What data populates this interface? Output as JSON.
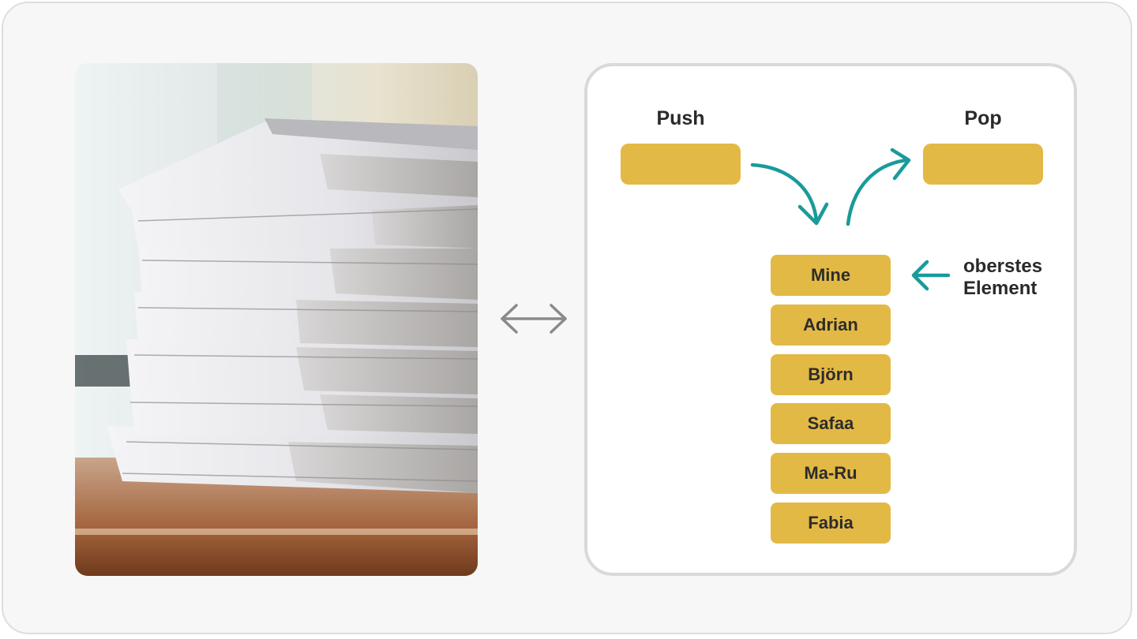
{
  "diagram": {
    "push_label": "Push",
    "pop_label": "Pop",
    "stack_items": [
      "Mine",
      "Adrian",
      "Björn",
      "Safaa",
      "Ma-Ru",
      "Fabia"
    ],
    "top_note_line1": "oberstes",
    "top_note_line2": "Element"
  },
  "colors": {
    "block": "#e3b945",
    "arrow_teal": "#1a9a9a",
    "arrow_gray": "#8a8a8a",
    "panel_border": "#d9d9d9",
    "background": "#f7f7f7"
  },
  "icons": [
    "double-headed-arrow-icon",
    "curved-arrow-icon",
    "left-arrow-icon"
  ]
}
